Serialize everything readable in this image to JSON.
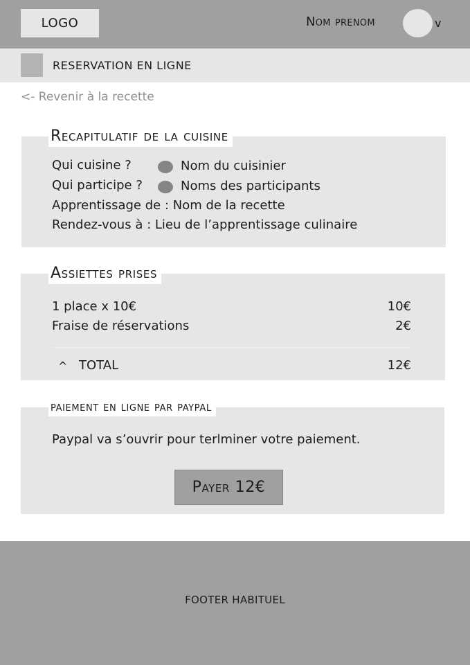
{
  "header": {
    "logo": "LOGO",
    "user_name": "Nom prenom",
    "avatar_icon": "user-avatar-placeholder",
    "menu_chevron": "v"
  },
  "subbar": {
    "icon": "image-placeholder-icon",
    "title": "RESERVATION EN LIGNE"
  },
  "back_link": "<- Revenir à la recette",
  "recap": {
    "title": "Recapitulatif de la cuisine",
    "who_cooks_label": "Qui cuisine ?",
    "who_cooks_value": "Nom du cuisinier",
    "who_participates_label": "Qui participe ?",
    "who_participates_value": "Noms des participants",
    "recipe_line": "Apprentissage de : Nom de la recette",
    "location_line": "Rendez-vous à : Lieu de l’apprentissage culinaire"
  },
  "plates": {
    "title": "Assiettes prises",
    "line1_label": "1 place x 10€",
    "line1_amount": "10€",
    "line2_label": "Fraise de réservations",
    "line2_amount": "2€",
    "total_caret": "^",
    "total_label": "TOTAL",
    "total_amount": "12€"
  },
  "payment": {
    "title": "paiement en ligne par paypal",
    "message": "Paypal va s’ouvrir pour terlminer votre paiement.",
    "pay_button": "Payer 12€"
  },
  "footer": {
    "text": "FOOTER HABITUEL"
  },
  "colors": {
    "header_bg": "#a0a0a0",
    "panel_bg": "#e6e6e6",
    "link_gray": "#8f8f8f",
    "dot_gray": "#858585"
  }
}
